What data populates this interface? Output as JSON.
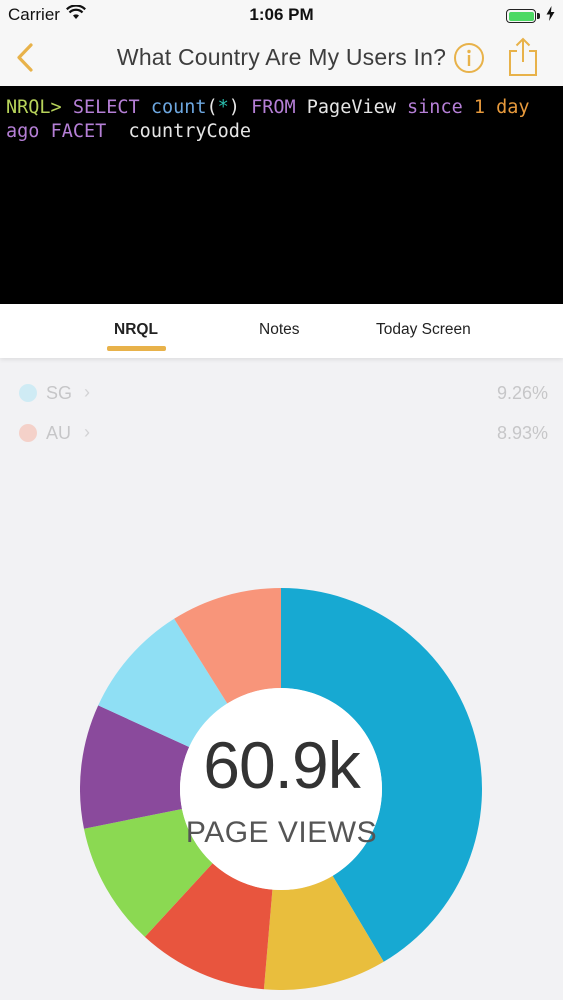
{
  "status_bar": {
    "carrier": "Carrier",
    "time": "1:06 PM"
  },
  "nav": {
    "title": "What Country Are My Users In?",
    "info_icon": "info-icon",
    "share_icon": "share-icon",
    "back_icon": "chevron-left-icon",
    "accent": "#e8b24a"
  },
  "query": {
    "tokens": [
      {
        "text": "NRQL>",
        "kind": "prompt"
      },
      {
        "text": " ",
        "kind": "space"
      },
      {
        "text": "SELECT",
        "kind": "kw"
      },
      {
        "text": " ",
        "kind": "space"
      },
      {
        "text": "count",
        "kind": "fn"
      },
      {
        "text": "(",
        "kind": "id"
      },
      {
        "text": "*",
        "kind": "op"
      },
      {
        "text": ")",
        "kind": "id"
      },
      {
        "text": " ",
        "kind": "space"
      },
      {
        "text": "FROM",
        "kind": "kw"
      },
      {
        "text": " ",
        "kind": "space"
      },
      {
        "text": "PageView",
        "kind": "id"
      },
      {
        "text": " ",
        "kind": "space"
      },
      {
        "text": "since",
        "kind": "kw"
      },
      {
        "text": " ",
        "kind": "space"
      },
      {
        "text": "1",
        "kind": "num"
      },
      {
        "text": " ",
        "kind": "space"
      },
      {
        "text": "day",
        "kind": "num"
      },
      {
        "text": " ",
        "kind": "space"
      },
      {
        "text": "ago",
        "kind": "kw"
      },
      {
        "text": " ",
        "kind": "space"
      },
      {
        "text": "FACET",
        "kind": "kw"
      },
      {
        "text": "  ",
        "kind": "space"
      },
      {
        "text": "countryCode",
        "kind": "id"
      }
    ]
  },
  "tabs": [
    {
      "label": "NRQL",
      "active": true
    },
    {
      "label": "Notes",
      "active": false
    },
    {
      "label": "Today Screen",
      "active": false
    }
  ],
  "legend": [
    {
      "code": "SG",
      "percent": "9.26%",
      "color": "#8fdff4"
    },
    {
      "code": "AU",
      "percent": "8.93%",
      "color": "#f8957a"
    }
  ],
  "chart": {
    "center_value": "60.9k",
    "center_label": "PAGE VIEWS"
  },
  "chart_data": {
    "type": "pie",
    "donut": true,
    "values": [
      41.5,
      9.9,
      10.5,
      10.0,
      10.0,
      9.26,
      8.93
    ],
    "colors": [
      "#17a9d2",
      "#e9be3d",
      "#e8553e",
      "#8bd952",
      "#8a4a9c",
      "#8fdff4",
      "#f8957a"
    ]
  }
}
